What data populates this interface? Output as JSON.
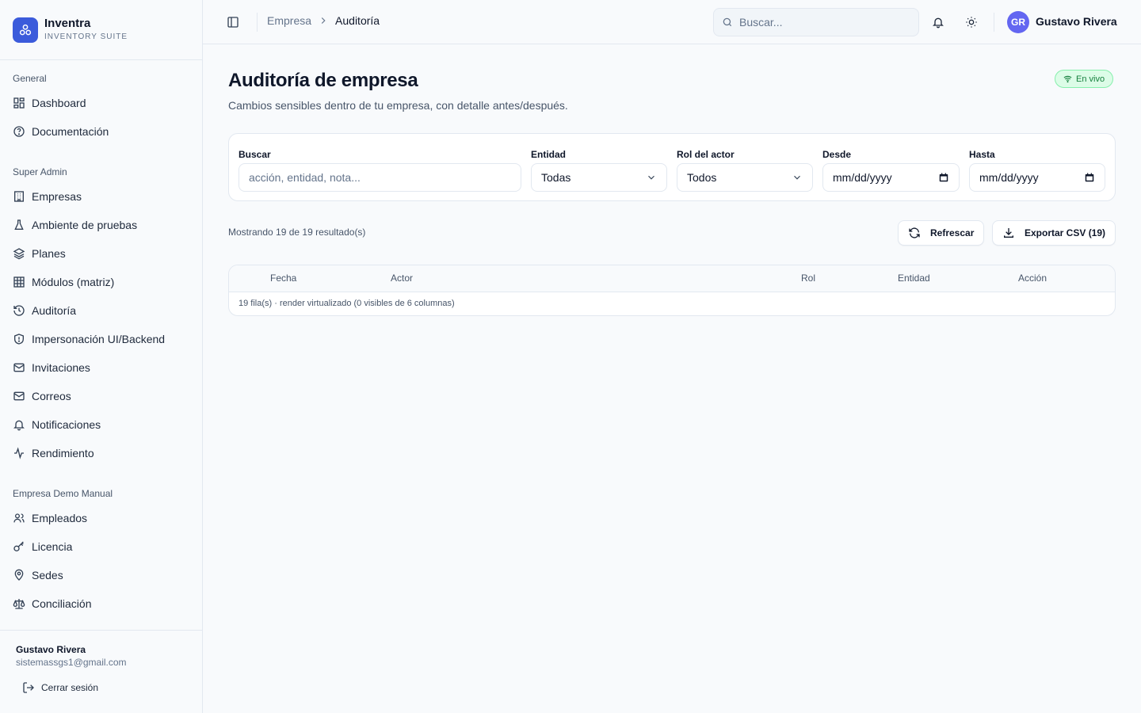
{
  "brand": {
    "name": "Inventra",
    "subtitle": "INVENTORY SUITE"
  },
  "sidebar": {
    "sections": [
      {
        "title": "General",
        "items": [
          {
            "label": "Dashboard",
            "icon": "grid-icon"
          },
          {
            "label": "Documentación",
            "icon": "help-circle-icon"
          }
        ]
      },
      {
        "title": "Super Admin",
        "items": [
          {
            "label": "Empresas",
            "icon": "building-icon"
          },
          {
            "label": "Ambiente de pruebas",
            "icon": "flask-icon"
          },
          {
            "label": "Planes",
            "icon": "layers-icon"
          },
          {
            "label": "Módulos (matriz)",
            "icon": "table-icon"
          },
          {
            "label": "Auditoría",
            "icon": "history-icon"
          },
          {
            "label": "Impersonación UI/Backend",
            "icon": "shield-icon"
          },
          {
            "label": "Invitaciones",
            "icon": "mail-icon"
          },
          {
            "label": "Correos",
            "icon": "mail-icon"
          },
          {
            "label": "Notificaciones",
            "icon": "bell-icon"
          },
          {
            "label": "Rendimiento",
            "icon": "activity-icon"
          }
        ]
      },
      {
        "title": "Empresa Demo Manual",
        "items": [
          {
            "label": "Empleados",
            "icon": "users-icon"
          },
          {
            "label": "Licencia",
            "icon": "key-icon"
          },
          {
            "label": "Sedes",
            "icon": "map-pin-icon"
          },
          {
            "label": "Conciliación",
            "icon": "scale-icon"
          }
        ]
      }
    ],
    "footer": {
      "name": "Gustavo Rivera",
      "email": "sistemassgs1@gmail.com",
      "logout_label": "Cerrar sesión"
    }
  },
  "header": {
    "breadcrumb": [
      "Empresa",
      "Auditoría"
    ],
    "search_placeholder": "Buscar...",
    "avatar_initials": "GR",
    "user_name": "Gustavo Rivera"
  },
  "main": {
    "title": "Auditoría de empresa",
    "subtitle": "Cambios sensibles dentro de tu empresa, con detalle antes/después.",
    "live_badge": "En vivo",
    "filters": {
      "search": {
        "label": "Buscar",
        "placeholder": "acción, entidad, nota..."
      },
      "entity": {
        "label": "Entidad",
        "value": "Todas"
      },
      "role": {
        "label": "Rol del actor",
        "value": "Todos"
      },
      "from": {
        "label": "Desde",
        "value": "mm/dd/yyyy"
      },
      "to": {
        "label": "Hasta",
        "value": "mm/dd/yyyy"
      }
    },
    "results_text": "Mostrando 19 de 19 resultado(s)",
    "refresh_label": "Refrescar",
    "export_label": "Exportar CSV (19)",
    "table": {
      "columns": [
        "Fecha",
        "Actor",
        "Rol",
        "Entidad",
        "Acción"
      ],
      "footer": "19 fila(s) · render virtualizado (0 visibles de 6 columnas)"
    }
  },
  "colors": {
    "accent": "#3b5bdb",
    "avatar": "#6366f1",
    "live": "#15803d"
  }
}
